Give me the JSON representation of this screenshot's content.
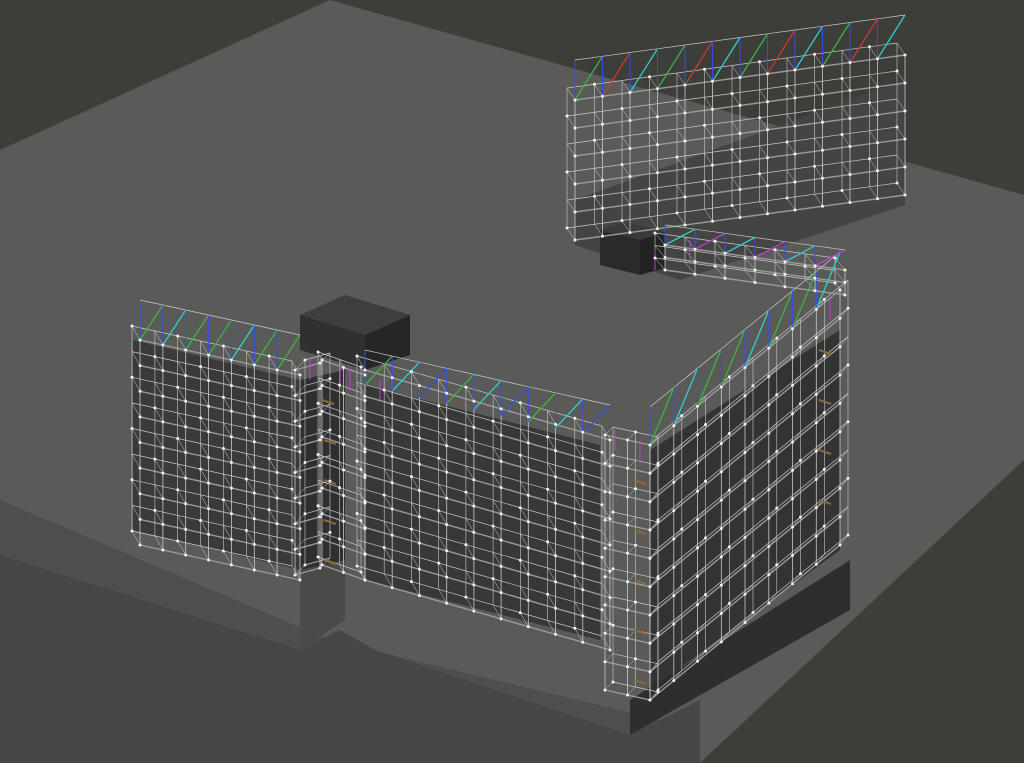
{
  "scene": {
    "background_color": "#3d3d39",
    "site_top_color": "#5a5a58",
    "site_left_face_color": "#4e4e4c",
    "site_right_face_color": "#464644",
    "pit_color": "#525250",
    "wall_face_color": "#353535",
    "wall_shadow_color": "#2c2c2c",
    "scaffold_tube_color": "#c9c9c9",
    "scaffold_deck_color": "#9a9a9a",
    "scaffold_node_color": "#f2f2f2",
    "brace_colors": {
      "green": "#3db53d",
      "blue": "#3350e6",
      "cyan": "#2fd0d0",
      "red": "#d23535",
      "magenta": "#c43bd6",
      "brown": "#8a6a3a"
    },
    "objects": [
      {
        "id": "site-platform",
        "label": ""
      },
      {
        "id": "building-west-wing",
        "label": ""
      },
      {
        "id": "building-central-wing",
        "label": ""
      },
      {
        "id": "building-east-wing",
        "label": ""
      },
      {
        "id": "building-north-wing",
        "label": ""
      },
      {
        "id": "rooftop-unit-1",
        "label": ""
      },
      {
        "id": "rooftop-unit-2",
        "label": ""
      }
    ]
  }
}
